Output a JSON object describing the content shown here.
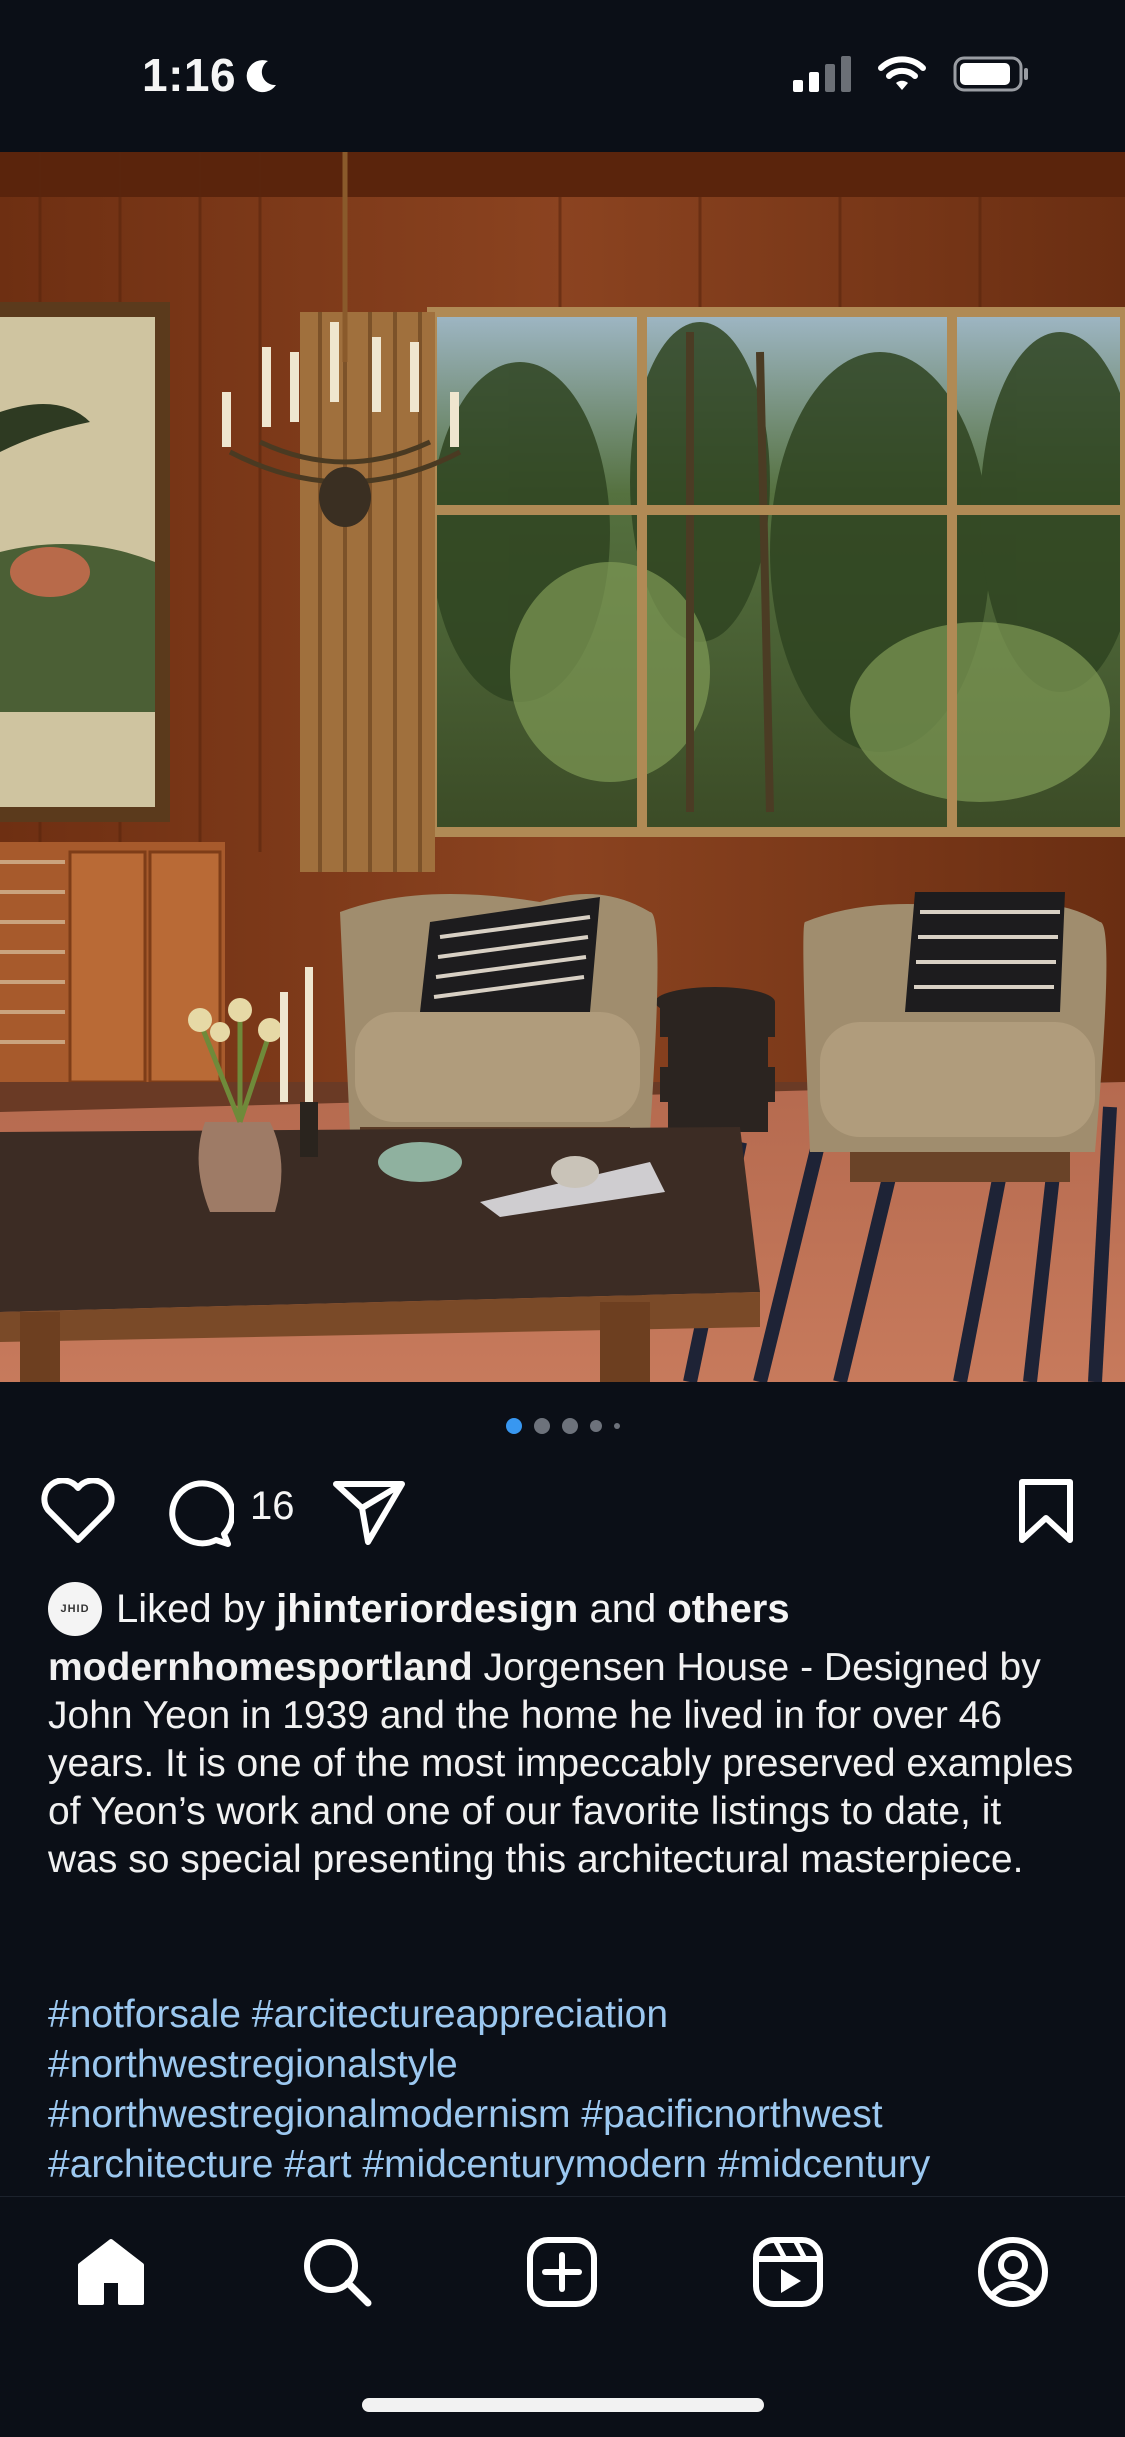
{
  "status": {
    "time": "1:16",
    "icons": [
      "moon-icon",
      "cellular-signal-icon",
      "wifi-icon",
      "battery-icon"
    ]
  },
  "post": {
    "carousel": {
      "slide_count": 5,
      "active_index": 0
    },
    "comment_count": "16",
    "liked_by": {
      "avatar_text": "JHID",
      "prefix": "Liked by",
      "user": "jhinteriordesign",
      "conjunction": "and",
      "others": "others"
    },
    "caption": {
      "username": "modernhomesportland",
      "text": "Jorgensen House - Designed by John Yeon in 1939 and the home he lived in for over 46 years. It is one of the most impeccably preserved examples of Yeon’s work and one of our favorite listings to date, it was so special presenting this architectural masterpiece."
    },
    "hashtags": [
      "#notforsale #arcitectureappreciation",
      "#northwestregionalstyle",
      "#northwestregionalmodernism #pacificnorthwest",
      "#architecture #art  #midcenturymodern #midcentury"
    ]
  },
  "colors": {
    "background": "#0b0f17",
    "hashtag": "#9cc8f0",
    "active_dot": "#3897f0"
  },
  "nav": {
    "items": [
      "home-icon",
      "search-icon",
      "create-icon",
      "reels-icon",
      "profile-icon"
    ]
  }
}
